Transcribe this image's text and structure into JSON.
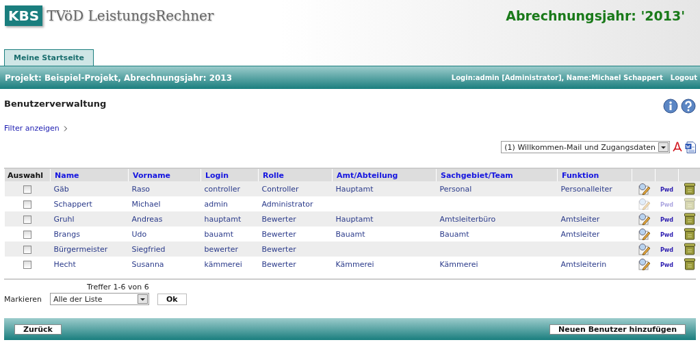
{
  "header": {
    "logo": "KBS",
    "app_title": "TVöD LeistungsRechner",
    "year_title": "Abrechnungsjahr: '2013'"
  },
  "tabs": [
    {
      "label": "Meine Startseite",
      "selected": true
    }
  ],
  "info_bar": {
    "project": "Projekt: Beispiel-Projekt, Abrechnungsjahr: 2013",
    "user": "Login:admin [Administrator], Name:Michael Schappert",
    "logout": "Logout"
  },
  "page_title": "Benutzerverwaltung",
  "filter_link": "Filter anzeigen",
  "export_select": {
    "value": "(1) Willkommen-Mail und Zugangsdaten"
  },
  "table": {
    "selection_header": "Auswahl",
    "columns": [
      "Name",
      "Vorname",
      "Login",
      "Rolle",
      "Amt/Abteilung",
      "Sachgebiet/Team",
      "Funktion"
    ],
    "rows": [
      {
        "checked": false,
        "cells": [
          "Gäb",
          "Raso",
          "controller",
          "Controller",
          "Hauptamt",
          "Personal",
          "Personalleiter"
        ],
        "pwd": "Pwd",
        "actions_disabled": false
      },
      {
        "checked": false,
        "cells": [
          "Schappert",
          "Michael",
          "admin",
          "Administrator",
          "",
          "",
          ""
        ],
        "pwd": "Pwd",
        "actions_disabled": true
      },
      {
        "checked": false,
        "cells": [
          "Gruhl",
          "Andreas",
          "hauptamt",
          "Bewerter",
          "Hauptamt",
          "Amtsleiterbüro",
          "Amtsleiter"
        ],
        "pwd": "Pwd",
        "actions_disabled": false
      },
      {
        "checked": false,
        "cells": [
          "Brangs",
          "Udo",
          "bauamt",
          "Bewerter",
          "Bauamt",
          "Bauamt",
          "Amtsleiter"
        ],
        "pwd": "Pwd",
        "actions_disabled": false
      },
      {
        "checked": false,
        "cells": [
          "Bürgermeister",
          "Siegfried",
          "bewerter",
          "Bewerter",
          "",
          "",
          ""
        ],
        "pwd": "Pwd",
        "actions_disabled": false
      },
      {
        "checked": false,
        "cells": [
          "Hecht",
          "Susanna",
          "kämmerei",
          "Bewerter",
          "Kämmerei",
          "Kämmerei",
          "Amtsleiterin"
        ],
        "pwd": "Pwd",
        "actions_disabled": false
      }
    ]
  },
  "hits": "Treffer 1-6 von 6",
  "mark": {
    "label": "Markieren",
    "value": "Alle der Liste",
    "ok": "Ok"
  },
  "footer": {
    "back": "Zurück",
    "add": "Neuen Benutzer hinzufügen"
  }
}
